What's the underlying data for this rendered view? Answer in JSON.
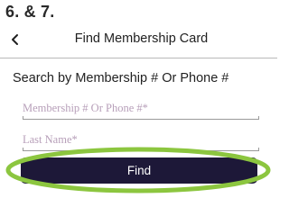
{
  "step_label": "6. & 7.",
  "header": {
    "back_icon": "chevron-left-icon",
    "title": "Find Membership Card"
  },
  "search": {
    "heading": "Search by Membership # Or Phone #",
    "membership_placeholder": "Membership # Or Phone #*",
    "membership_value": "",
    "lastname_placeholder": "Last Name*",
    "lastname_value": ""
  },
  "find_button": {
    "label": "Find"
  },
  "colors": {
    "button_bg": "#1d1838",
    "highlight": "#8cc63f",
    "placeholder": "#b79fb9"
  }
}
